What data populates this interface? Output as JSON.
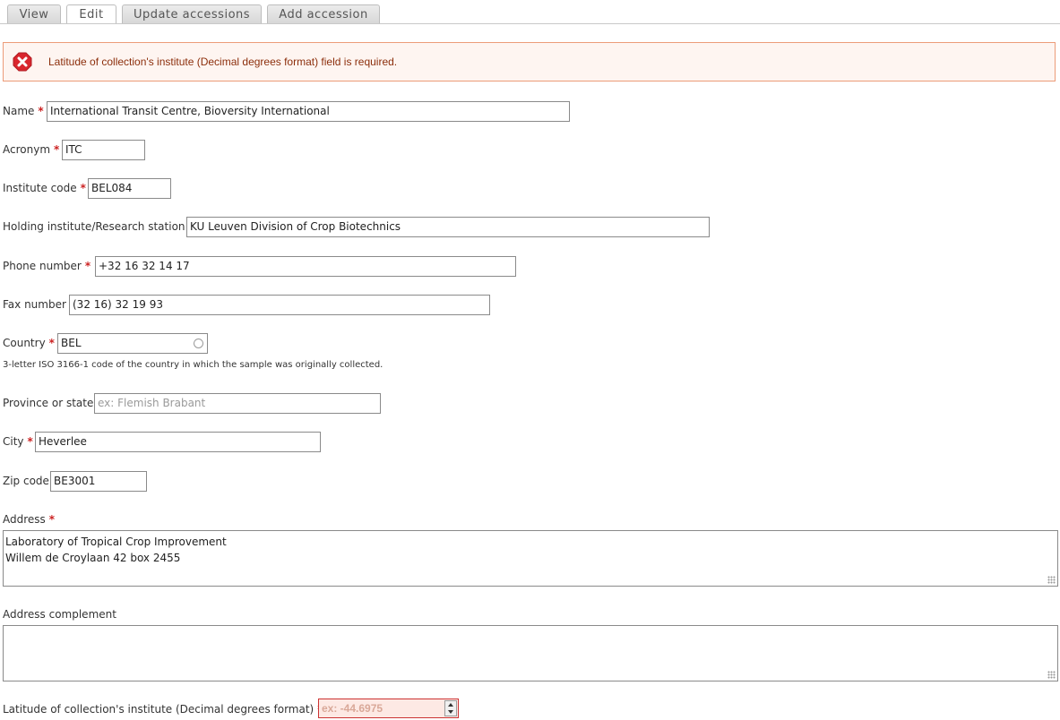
{
  "tabs": [
    {
      "label": "View"
    },
    {
      "label": "Edit"
    },
    {
      "label": "Update accessions"
    },
    {
      "label": "Add accession"
    }
  ],
  "error": {
    "message": "Latitude of collection's institute (Decimal degrees format) field is required."
  },
  "form": {
    "required_marker": "*",
    "name": {
      "label": "Name",
      "value": "International Transit Centre, Bioversity International"
    },
    "acronym": {
      "label": "Acronym",
      "value": "ITC"
    },
    "institute_code": {
      "label": "Institute code",
      "value": "BEL084"
    },
    "holding": {
      "label": "Holding institute/Research station",
      "value": "KU Leuven Division of Crop Biotechnics"
    },
    "phone": {
      "label": "Phone number",
      "value": "+32 16 32 14 17"
    },
    "fax": {
      "label": "Fax number",
      "value": "(32 16) 32 19 93"
    },
    "country": {
      "label": "Country",
      "value": "BEL",
      "description": "3-letter ISO 3166-1 code of the country in which the sample was originally collected."
    },
    "province": {
      "label": "Province or state",
      "placeholder": "ex: Flemish Brabant"
    },
    "city": {
      "label": "City",
      "value": "Heverlee"
    },
    "zip": {
      "label": "Zip code",
      "value": "BE3001"
    },
    "address": {
      "label": "Address",
      "line1": "Laboratory of Tropical Crop Improvement",
      "line2": "Willem de Croylaan 42 box 2455"
    },
    "address_complement": {
      "label": "Address complement"
    },
    "latitude": {
      "label": "Latitude of collection's institute (Decimal degrees format)",
      "placeholder": "ex: -44.6975"
    }
  },
  "colors": {
    "error_border": "#ec9c79",
    "error_bg": "#fef5f1",
    "error_text": "#8c2e0b",
    "required": "#cc2222"
  }
}
